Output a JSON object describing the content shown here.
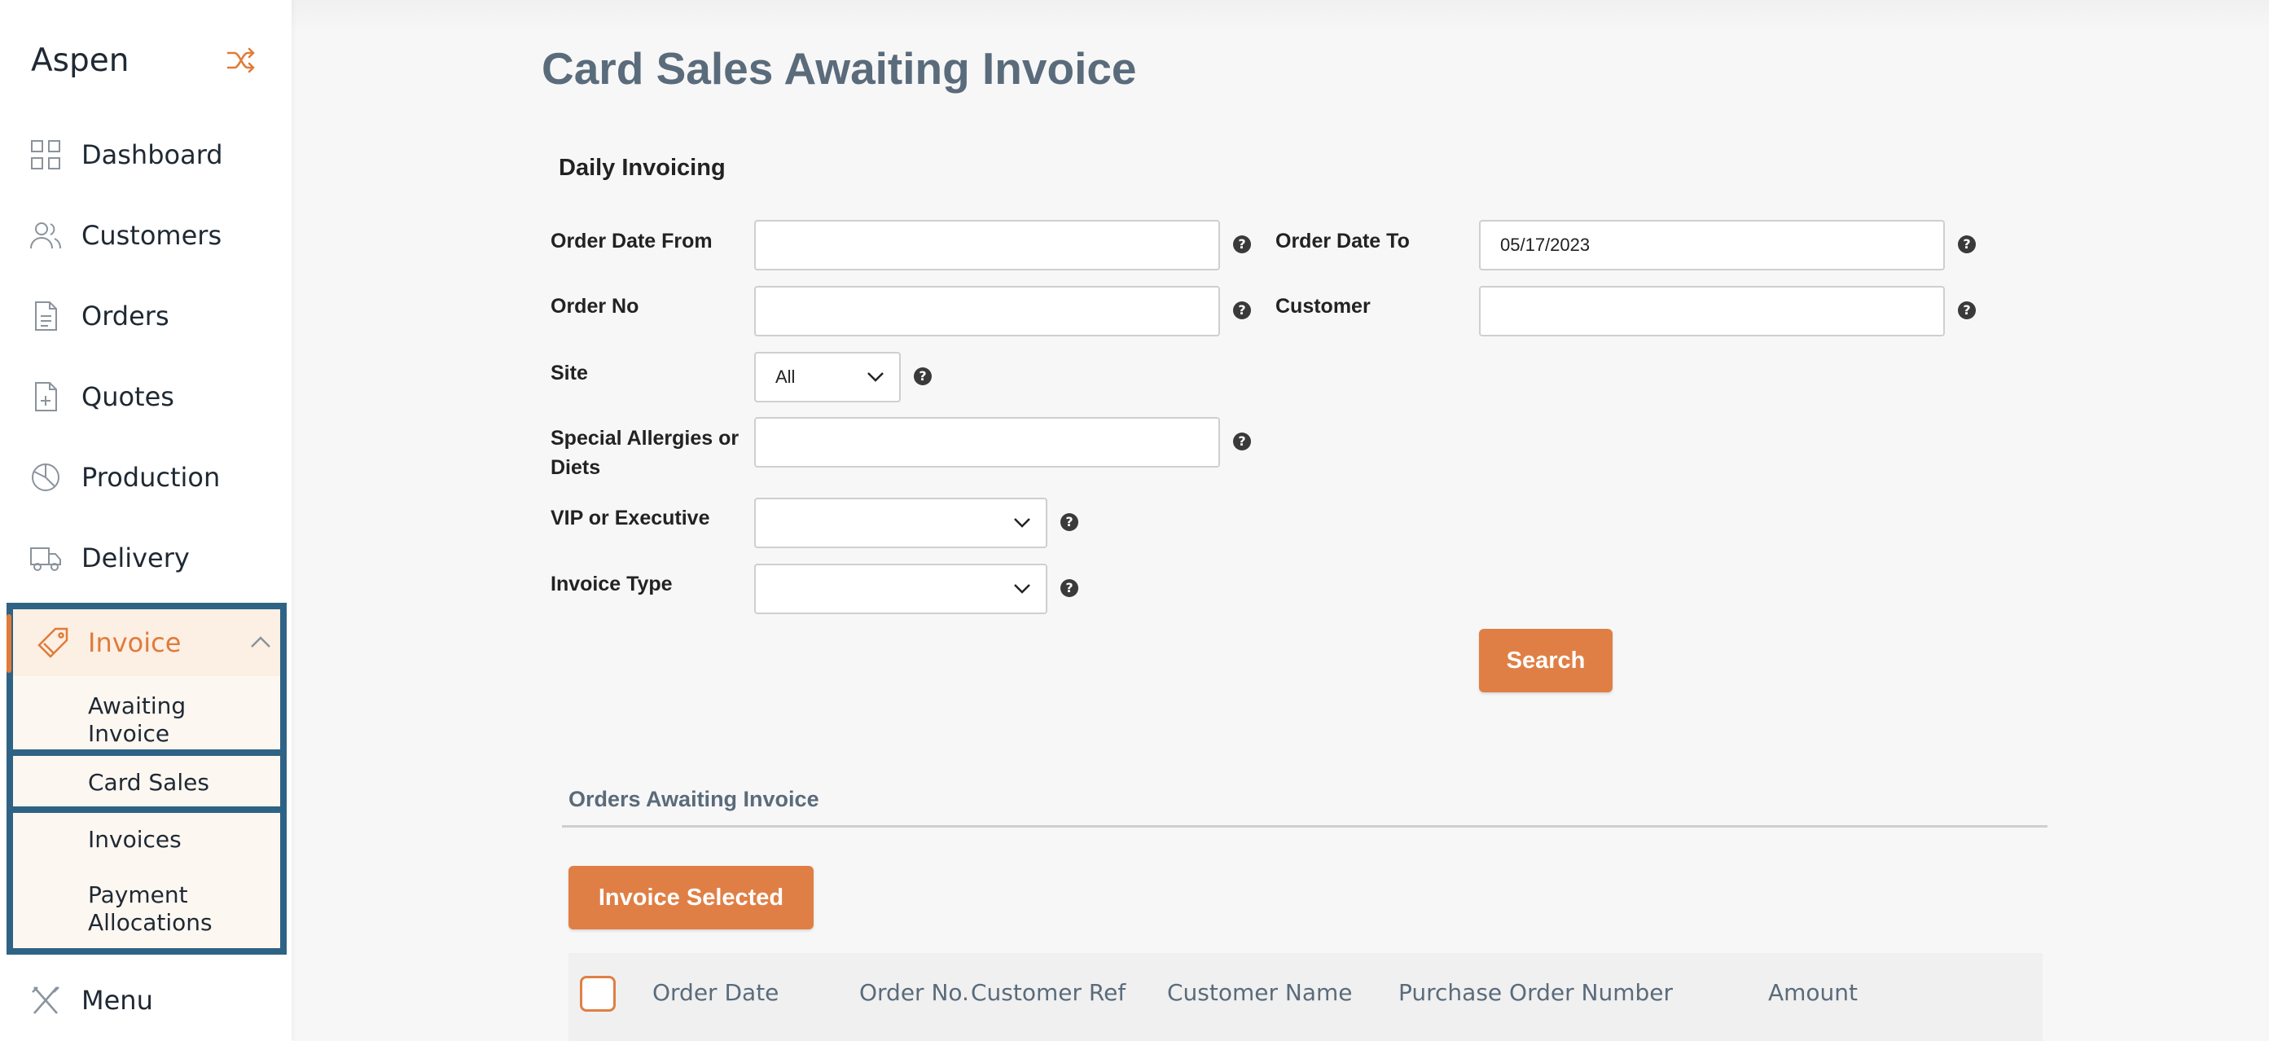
{
  "sidebar": {
    "brand": "Aspen",
    "items": [
      {
        "label": "Dashboard",
        "icon": "grid-icon"
      },
      {
        "label": "Customers",
        "icon": "users-icon"
      },
      {
        "label": "Orders",
        "icon": "document-icon"
      },
      {
        "label": "Quotes",
        "icon": "file-plus-icon"
      },
      {
        "label": "Production",
        "icon": "pie-chart-icon"
      },
      {
        "label": "Delivery",
        "icon": "truck-icon"
      }
    ],
    "invoice": {
      "label": "Invoice",
      "sub": [
        "Awaiting Invoice",
        "Card Sales",
        "Invoices",
        "Payment Allocations"
      ]
    },
    "menu": {
      "label": "Menu"
    }
  },
  "page": {
    "title": "Card Sales Awaiting Invoice"
  },
  "form": {
    "section_title": "Daily Invoicing",
    "order_date_from": {
      "label": "Order Date From",
      "value": ""
    },
    "order_date_to": {
      "label": "Order Date To",
      "value": "05/17/2023"
    },
    "order_no": {
      "label": "Order No",
      "value": ""
    },
    "customer": {
      "label": "Customer",
      "value": ""
    },
    "site": {
      "label": "Site",
      "value": "All"
    },
    "special_allergies": {
      "label": "Special Allergies or Diets",
      "value": ""
    },
    "vip": {
      "label": "VIP or Executive",
      "value": ""
    },
    "invoice_type": {
      "label": "Invoice Type",
      "value": ""
    },
    "search_label": "Search",
    "help_glyph": "?"
  },
  "orders": {
    "title": "Orders Awaiting Invoice",
    "invoice_selected_label": "Invoice Selected",
    "columns": [
      "Order Date",
      "Order No.",
      "Customer Ref",
      "Customer Name",
      "Purchase Order Number",
      "Amount"
    ]
  },
  "colors": {
    "accent": "#e07f45",
    "highlight_border": "#2e6385",
    "title": "#5a6b7b"
  }
}
